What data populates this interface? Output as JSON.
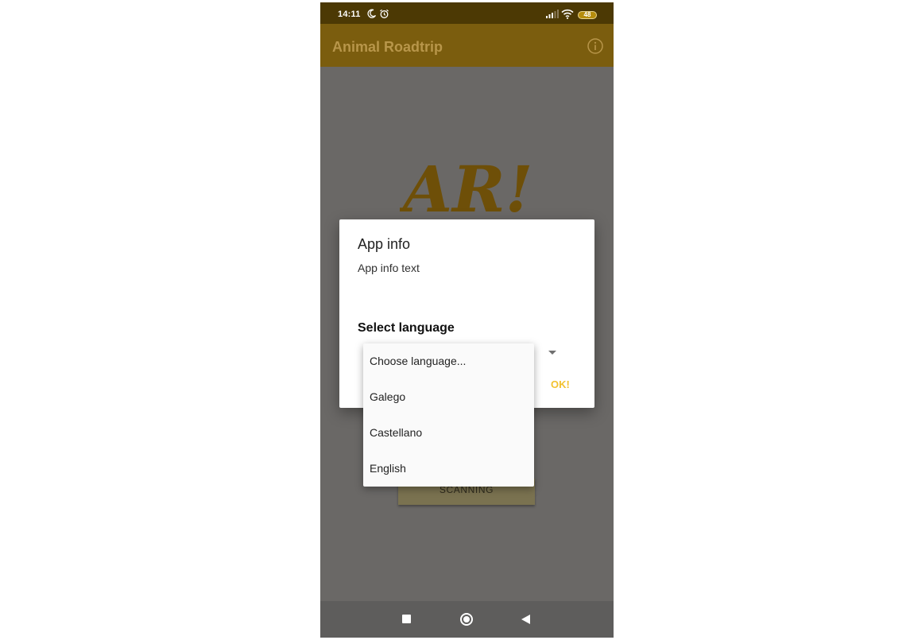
{
  "status_bar": {
    "time": "14:11",
    "battery": "48",
    "icons": [
      "moon-icon",
      "alarm-icon",
      "signal-icon",
      "wifi-icon",
      "battery-icon"
    ]
  },
  "app_bar": {
    "title": "Animal Roadtrip",
    "info_icon": "info-icon"
  },
  "main": {
    "logo_text": "AR!",
    "scan_button": "SCANNING"
  },
  "dialog": {
    "title": "App info",
    "text": "App info text",
    "language_label": "Select language",
    "ok_label": "OK!",
    "language_options": [
      "Choose language...",
      "Galego",
      "Castellano",
      "English"
    ]
  },
  "colors": {
    "status_bar": "#4c3904",
    "app_bar": "#7b5d0e",
    "accent": "#f2c230",
    "logo": "#6e4f08",
    "scrim_background": "#6a6866"
  },
  "nav_bar": {
    "icons": [
      "recents-icon",
      "home-icon",
      "back-icon"
    ]
  }
}
